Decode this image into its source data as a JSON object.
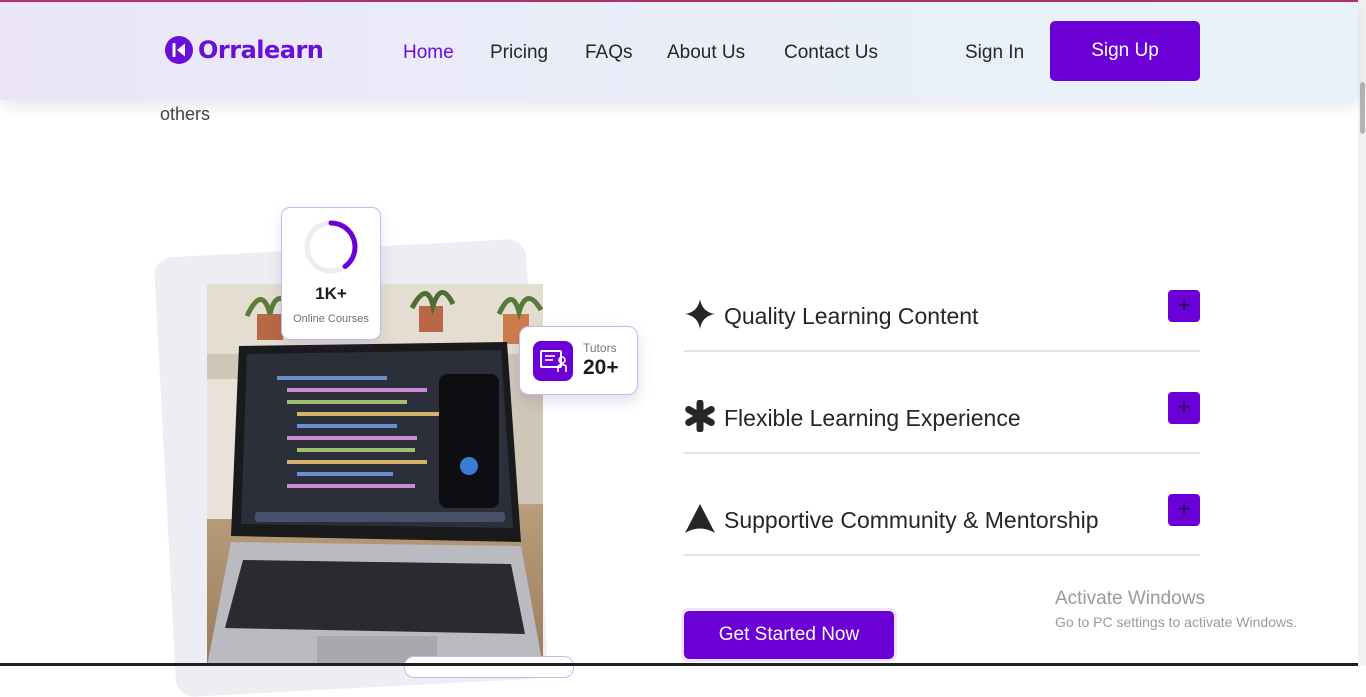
{
  "brand": {
    "name": "Orralearn",
    "color": "#6a0fd8",
    "accent": "#6a00d6"
  },
  "nav": {
    "items": [
      {
        "label": "Home",
        "active": true
      },
      {
        "label": "Pricing",
        "active": false
      },
      {
        "label": "FAQs",
        "active": false
      },
      {
        "label": "About Us",
        "active": false
      },
      {
        "label": "Contact Us",
        "active": false
      }
    ],
    "sign_in": "Sign In",
    "sign_up": "Sign Up"
  },
  "section": {
    "partial_text": "others"
  },
  "stats": {
    "courses": {
      "value": "1K+",
      "label": "Online Courses",
      "progress": 0.4
    },
    "tutors": {
      "label": "Tutors",
      "value": "20+"
    }
  },
  "features": [
    {
      "title": "Quality Learning Content",
      "icon": "sparkle-icon",
      "button": "+"
    },
    {
      "title": "Flexible Learning Experience",
      "icon": "asterisk-icon",
      "button": "+"
    },
    {
      "title": "Supportive Community & Mentorship",
      "icon": "arrow-up-icon",
      "button": "+"
    }
  ],
  "cta": {
    "label": "Get Started Now"
  },
  "watermark": {
    "title": "Activate Windows",
    "subtitle": "Go to PC settings to activate Windows."
  }
}
